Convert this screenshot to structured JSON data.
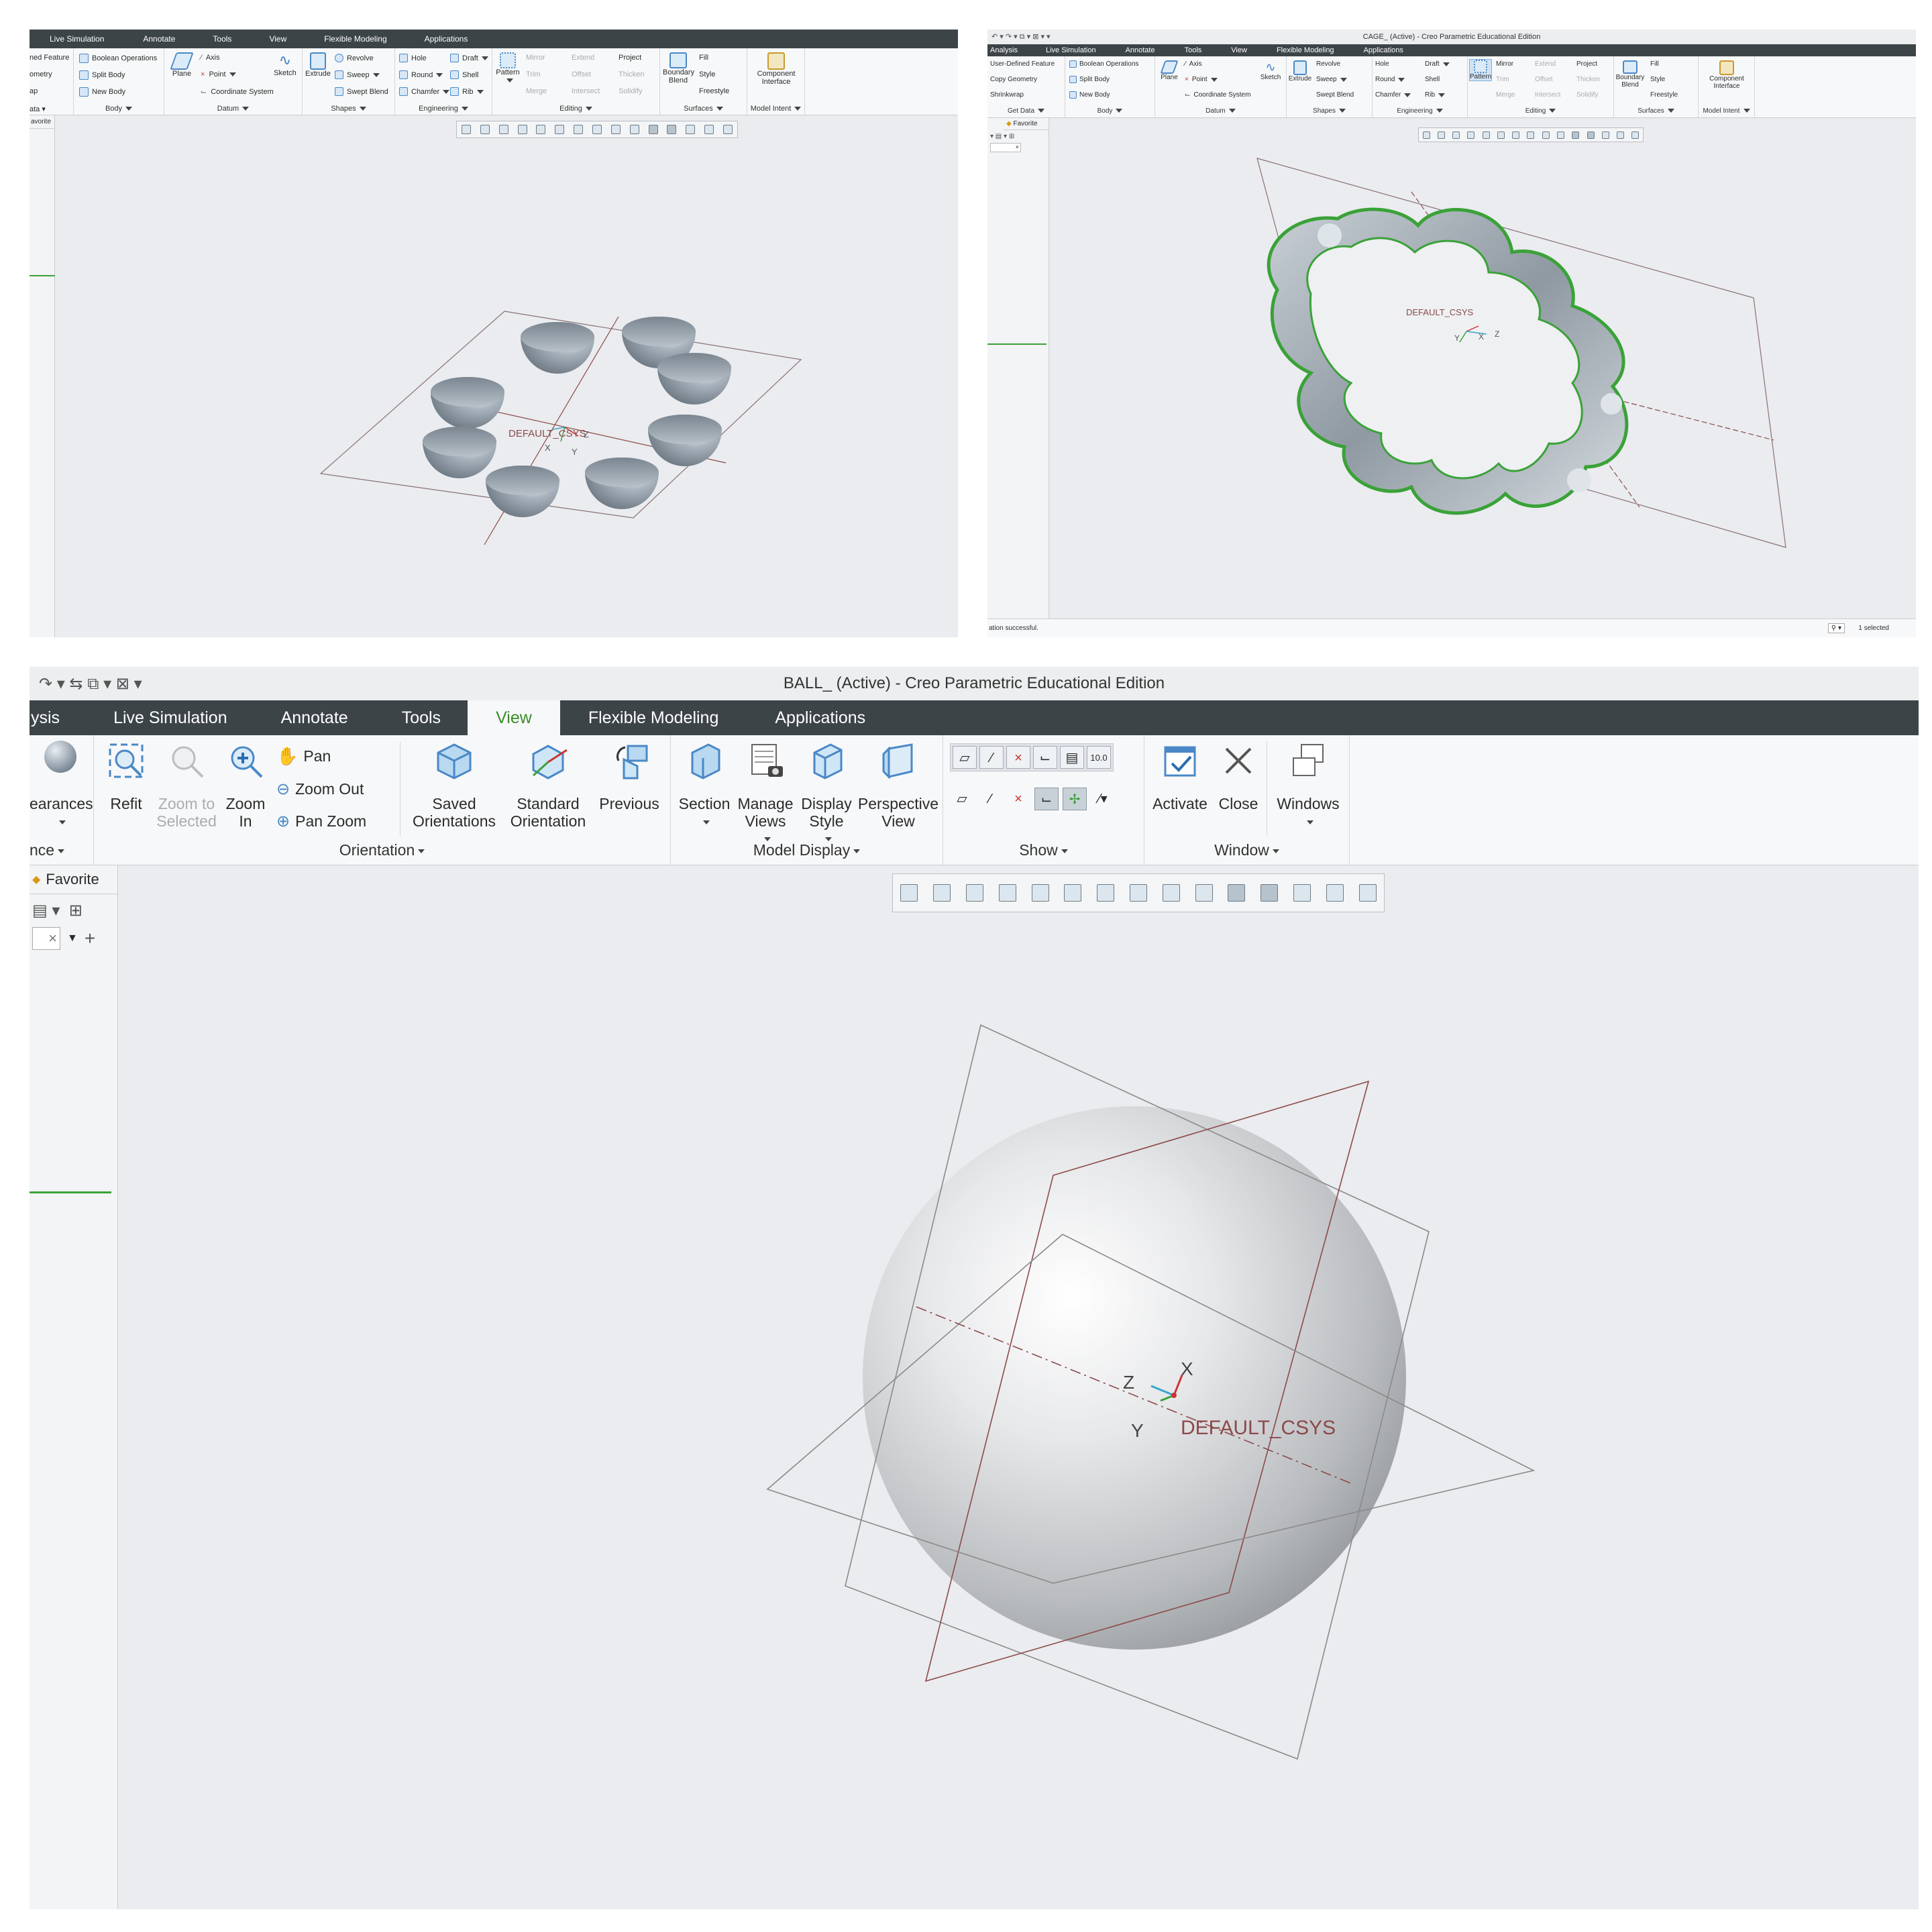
{
  "panels": {
    "top_left": {
      "tabs": [
        "Live Simulation",
        "Annotate",
        "Tools",
        "View",
        "Flexible Modeling",
        "Applications"
      ],
      "left_cut_labels": [
        "ned Feature",
        "ometry",
        "ap",
        "ata ▾"
      ],
      "ribbon": {
        "body": {
          "items": [
            "Boolean Operations",
            "Split Body",
            "New Body"
          ],
          "label": "Body"
        },
        "datum": {
          "plane": "Plane",
          "items": [
            "Axis",
            "Point",
            "Coordinate System"
          ],
          "sketch": "Sketch",
          "label": "Datum"
        },
        "shapes": {
          "extrude": "Extrude",
          "items": [
            "Revolve",
            "Sweep",
            "Swept Blend"
          ],
          "label": "Shapes"
        },
        "engineering": {
          "items": [
            "Hole",
            "Round",
            "Chamfer",
            "Draft",
            "Shell",
            "Rib"
          ],
          "label": "Engineering"
        },
        "editing": {
          "pattern": "Pattern",
          "items": [
            "Mirror",
            "Trim",
            "Merge",
            "Extend",
            "Offset",
            "Intersect",
            "Project",
            "Thicken",
            "Solidify"
          ],
          "label": "Editing"
        },
        "surfaces": {
          "boundary_blend": "Boundary Blend",
          "items": [
            "Fill",
            "Style",
            "Freestyle"
          ],
          "label": "Surfaces"
        },
        "model_intent": {
          "component_interface": "Component Interface",
          "label": "Model Intent"
        }
      },
      "left_panel": {
        "favorites": "avorite"
      },
      "viewport": {
        "csys_label": "DEFAULT_CSYS",
        "axes": [
          "X",
          "Y",
          "Z"
        ]
      }
    },
    "top_right": {
      "title": "CAGE_ (Active) - Creo Parametric Educational Edition",
      "tabs": [
        "Analysis",
        "Live Simulation",
        "Annotate",
        "Tools",
        "View",
        "Flexible Modeling",
        "Applications"
      ],
      "ribbon": {
        "get_data": {
          "items": [
            "User-Defined Feature",
            "Copy Geometry",
            "Shrinkwrap"
          ],
          "label": "Get Data"
        },
        "body": {
          "items": [
            "Boolean Operations",
            "Split Body",
            "New Body"
          ],
          "label": "Body"
        },
        "datum": {
          "plane": "Plane",
          "items": [
            "Axis",
            "Point",
            "Coordinate System"
          ],
          "sketch": "Sketch",
          "label": "Datum"
        },
        "shapes": {
          "extrude": "Extrude",
          "items": [
            "Revolve",
            "Sweep",
            "Swept Blend"
          ],
          "label": "Shapes"
        },
        "engineering": {
          "items": [
            "Hole",
            "Round",
            "Chamfer",
            "Draft",
            "Shell",
            "Rib"
          ],
          "label": "Engineering"
        },
        "editing": {
          "pattern": "Pattern",
          "items": [
            "Mirror",
            "Trim",
            "Merge",
            "Extend",
            "Offset",
            "Intersect",
            "Project",
            "Thicken",
            "Solidify"
          ],
          "label": "Editing"
        },
        "surfaces": {
          "boundary_blend": "Boundary Blend",
          "items": [
            "Fill",
            "Style",
            "Freestyle"
          ],
          "label": "Surfaces"
        },
        "model_intent": {
          "component_interface": "Component Interface",
          "label": "Model Intent"
        }
      },
      "left_panel": {
        "favorites": "Favorite"
      },
      "viewport": {
        "csys_label": "DEFAULT_CSYS",
        "axes": [
          "X",
          "Y",
          "Z"
        ]
      },
      "status": {
        "message": "ation successful.",
        "selection": "1 selected"
      }
    },
    "bottom": {
      "title": "BALL_ (Active) - Creo Parametric Educational Edition",
      "tabs": [
        "ysis",
        "Live Simulation",
        "Annotate",
        "Tools",
        "View",
        "Flexible Modeling",
        "Applications"
      ],
      "active_tab": "View",
      "ribbon": {
        "appearance": {
          "label": "earances",
          "group_label": "nce"
        },
        "orientation": {
          "refit": "Refit",
          "zoom_to_selected": "Zoom to Selected",
          "zoom_in": "Zoom In",
          "pan": "Pan",
          "zoom_out": "Zoom Out",
          "pan_zoom": "Pan Zoom",
          "saved_orientations": "Saved Orientations",
          "standard_orientation": "Standard Orientation",
          "previous": "Previous",
          "label": "Orientation"
        },
        "model_display": {
          "section": "Section",
          "manage_views": "Manage Views",
          "display_style": "Display Style",
          "perspective_view": "Perspective View",
          "label": "Model Display"
        },
        "show": {
          "label": "Show",
          "note_value": "10.0"
        },
        "window": {
          "activate": "Activate",
          "close": "Close",
          "windows": "Windows",
          "label": "Window"
        }
      },
      "left_panel": {
        "favorites": "Favorite"
      },
      "viewport": {
        "csys_label": "DEFAULT_CSYS",
        "axes": [
          "X",
          "Y",
          "Z"
        ]
      }
    }
  },
  "colors": {
    "tabbar": "#3d4448",
    "active_tab_text": "#3a8d29",
    "model_outline": "#3aa238",
    "datum_plane": "#8a6f78",
    "csys_text": "#8c4a4a"
  }
}
